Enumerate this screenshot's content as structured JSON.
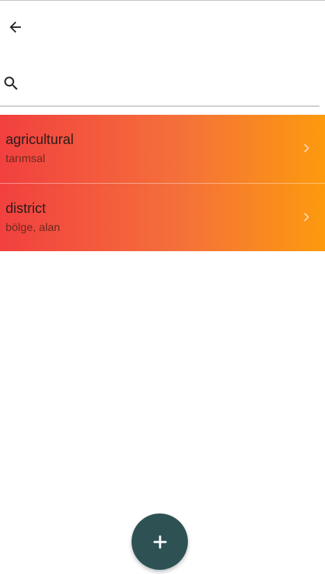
{
  "search": {
    "placeholder": "",
    "value": ""
  },
  "words": [
    {
      "term": "agricultural",
      "translation": "tarımsal"
    },
    {
      "term": "district",
      "translation": "bölge, alan"
    }
  ],
  "icons": {
    "back": "arrow-left-icon",
    "search": "search-icon",
    "item_chevron": "chevron-right-icon",
    "add": "plus-icon"
  },
  "colors": {
    "item_gradient_start": "#f2403f",
    "item_gradient_end": "#fd9a0e",
    "fab": "#2e5253"
  }
}
